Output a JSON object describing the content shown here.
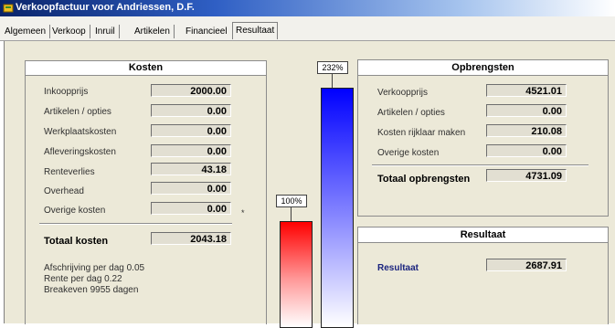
{
  "window": {
    "title": "Verkoopfactuur voor Andriessen, D.F."
  },
  "tabs": [
    "Algemeen",
    "Verkoop",
    "Inruil",
    "Artikelen",
    "Financieel",
    "Resultaat"
  ],
  "kosten": {
    "heading": "Kosten",
    "rows": [
      {
        "label": "Inkoopprijs",
        "value": "2000.00"
      },
      {
        "label": "Artikelen / opties",
        "value": "0.00"
      },
      {
        "label": "Werkplaatskosten",
        "value": "0.00"
      },
      {
        "label": "Afleveringskosten",
        "value": "0.00"
      },
      {
        "label": "Renteverlies",
        "value": "43.18"
      },
      {
        "label": "Overhead",
        "value": "0.00"
      },
      {
        "label": "Overige kosten",
        "value": "0.00"
      }
    ],
    "star": "*",
    "total_label": "Totaal kosten",
    "total_value": "2043.18",
    "notes": [
      "Afschrijving per dag 0.05",
      "Rente per dag 0.22",
      "Breakeven 9955 dagen"
    ]
  },
  "opbrengsten": {
    "heading": "Opbrengsten",
    "rows": [
      {
        "label": "Verkoopprijs",
        "value": "4521.01"
      },
      {
        "label": "Artikelen / opties",
        "value": "0.00"
      },
      {
        "label": "Kosten rijklaar maken",
        "value": "210.08"
      },
      {
        "label": "Overige kosten",
        "value": "0.00"
      }
    ],
    "total_label": "Totaal opbrengsten",
    "total_value": "4731.09"
  },
  "resultaat": {
    "heading": "Resultaat",
    "label": "Resultaat",
    "value": "2687.91"
  },
  "bars": {
    "kosten_pct_label": "100%",
    "opbrengsten_pct_label": "232%",
    "kosten_pct": 100,
    "opbrengsten_pct": 232,
    "kosten_color": "#ff0000",
    "opbrengsten_color": "#0000ff"
  }
}
